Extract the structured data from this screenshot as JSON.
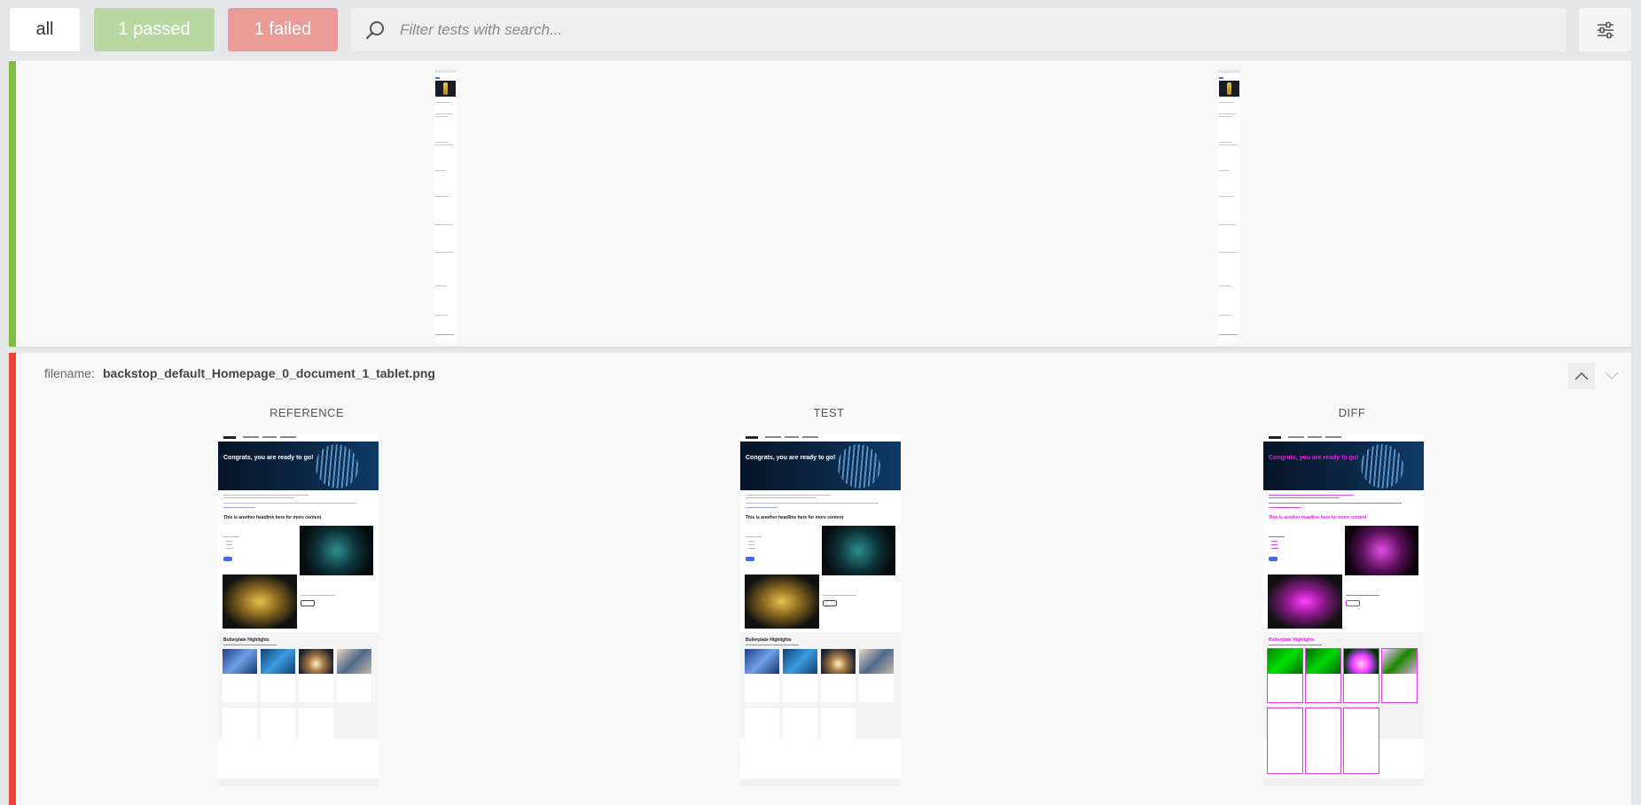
{
  "filters": {
    "all_label": "all",
    "passed_label": "1 passed",
    "failed_label": "1 failed",
    "search_placeholder": "Filter tests with search..."
  },
  "colors": {
    "passed_accent": "#7fbf3f",
    "failed_accent": "#e8443a",
    "passed_button": "#b7d8a1",
    "failed_button": "#ec9a96",
    "diff_highlight": "#e11ee0"
  },
  "icons": {
    "search": "search-icon",
    "settings": "sliders-icon",
    "collapse": "chevron-up-icon",
    "expand": "chevron-down-icon"
  },
  "failed_test": {
    "filename_label": "filename:",
    "filename": "backstop_default_Homepage_0_document_1_tablet.png",
    "columns": [
      "REFERENCE",
      "TEST",
      "DIFF"
    ]
  },
  "thumbnail": {
    "hero_title": "Congrats, you are ready to go!",
    "headline": "This is another headline here for more content",
    "section_title": "Boilerplate Highlights"
  }
}
